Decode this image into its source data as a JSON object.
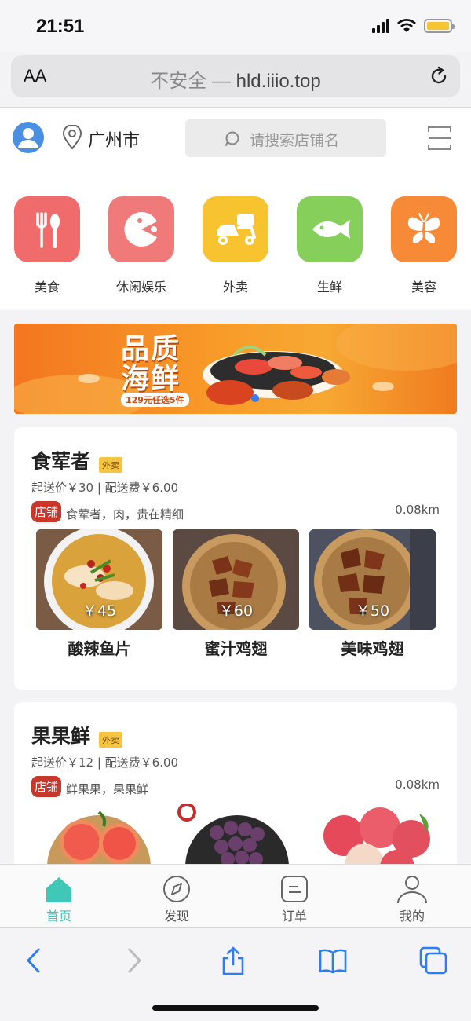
{
  "status": {
    "time": "21:51"
  },
  "browser": {
    "aa_label": "AA",
    "url_insecure": "不安全 —",
    "url_host": "hld.iiio.top"
  },
  "header": {
    "city": "广州市",
    "search_placeholder": "请搜索店铺名"
  },
  "categories": [
    {
      "label": "美食",
      "icon": "fork-spoon-icon",
      "color": "#f06b6b"
    },
    {
      "label": "休闲娱乐",
      "icon": "pacman-icon",
      "color": "#f07a7a"
    },
    {
      "label": "外卖",
      "icon": "scooter-icon",
      "color": "#f7c430"
    },
    {
      "label": "生鲜",
      "icon": "fish-icon",
      "color": "#86cf5a"
    },
    {
      "label": "美容",
      "icon": "butterfly-icon",
      "color": "#f68a36"
    }
  ],
  "banner": {
    "title_line1": "品质",
    "title_line2": "海鲜",
    "subtitle": "129元任选5件"
  },
  "stores": [
    {
      "name": "食荤者",
      "tag": "外卖",
      "fee": "起送价￥30 | 配送费￥6.00",
      "badge": "店铺",
      "desc": "食荤者，肉，贵在精细",
      "distance": "0.08km",
      "dishes": [
        {
          "name": "酸辣鱼片",
          "price": "￥45"
        },
        {
          "name": "蜜汁鸡翅",
          "price": "￥60"
        },
        {
          "name": "美味鸡翅",
          "price": "￥50"
        }
      ]
    },
    {
      "name": "果果鲜",
      "tag": "外卖",
      "fee": "起送价￥12 | 配送费￥6.00",
      "badge": "店铺",
      "desc": "鲜果果，果果鲜",
      "distance": "0.08km"
    }
  ],
  "tabbar": [
    {
      "label": "首页",
      "icon": "home-icon",
      "active": true
    },
    {
      "label": "发现",
      "icon": "compass-icon",
      "active": false
    },
    {
      "label": "订单",
      "icon": "order-icon",
      "active": false
    },
    {
      "label": "我的",
      "icon": "user-icon",
      "active": false
    }
  ],
  "colors": {
    "accent": "#3fc7b7",
    "safari_blue": "#2f7df6",
    "shop_badge": "#c8372b"
  }
}
